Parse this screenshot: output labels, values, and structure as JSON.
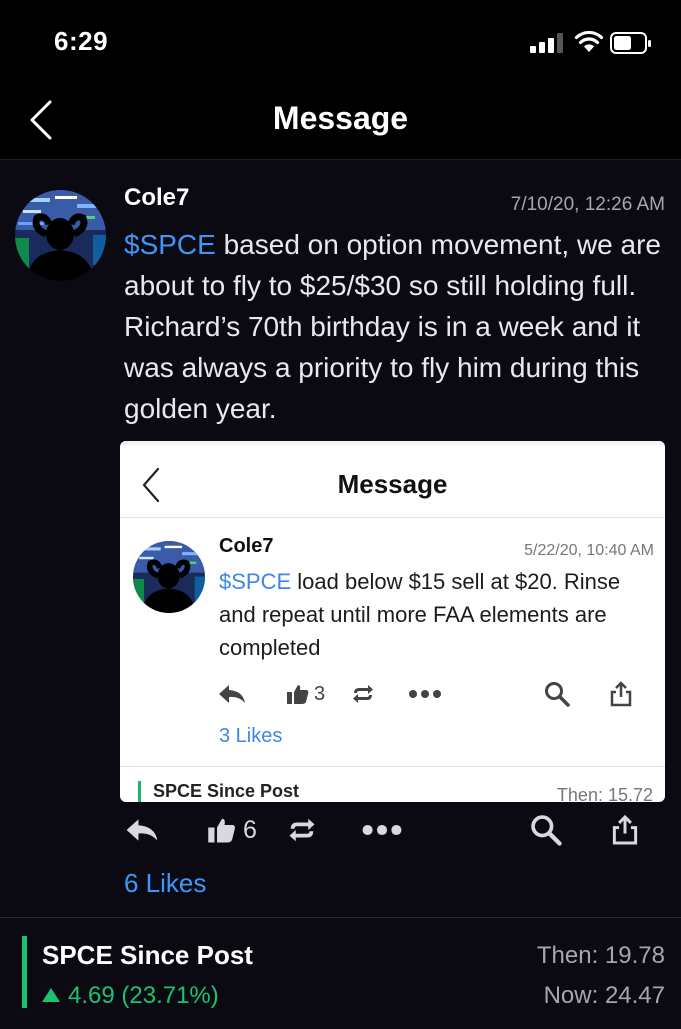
{
  "status_bar": {
    "time": "6:29"
  },
  "nav": {
    "title": "Message"
  },
  "post": {
    "username": "Cole7",
    "timestamp": "7/10/20, 12:26 AM",
    "cashtag": "$SPCE",
    "text": " based on option movement, we are about to fly to $25/$30 so still holding full. Richard’s 70th birthday is in a week and it was always a priority to fly him during this golden year.",
    "like_count": "6",
    "likes_label": "6 Likes"
  },
  "embed": {
    "nav_title": "Message",
    "username": "Cole7",
    "timestamp": "5/22/20, 10:40 AM",
    "cashtag": "$SPCE",
    "text": " load below $15 sell at $20. Rinse and repeat until more FAA elements are completed",
    "like_count": "3",
    "likes_label": "3 Likes",
    "since_label": "SPCE Since Post",
    "then_label": "Then: 15.72"
  },
  "footer": {
    "since_label": "SPCE Since Post",
    "change": "4.69 (23.71%)",
    "then": "Then: 19.78",
    "now": "Now: 24.47"
  },
  "colors": {
    "accent": "#3e97f6",
    "positive": "#1bc26f",
    "background": "#0b0a12"
  },
  "icons": [
    "back-chevron-icon",
    "reply-icon",
    "thumbs-up-icon",
    "reshare-icon",
    "more-icon",
    "search-icon",
    "share-icon",
    "signal-icon",
    "wifi-icon",
    "battery-icon"
  ]
}
